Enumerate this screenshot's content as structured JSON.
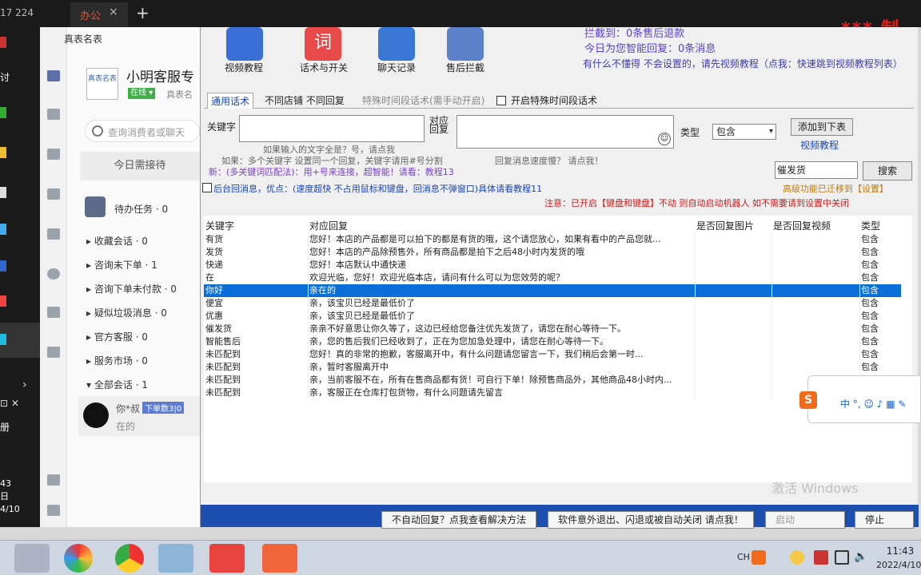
{
  "browser": {
    "left_text": "17 224",
    "tab_label": "办公",
    "close": "×",
    "new_tab": "+",
    "overlay_text": "*** 制"
  },
  "left_strip": {
    "clock_lines": [
      "43",
      "日",
      "4/10"
    ],
    "side_chars": [
      "讨",
      "册"
    ]
  },
  "customer_panel": {
    "title": "真表名表",
    "logo_text": "真表名表",
    "name": "小明客服专",
    "status": "在线 ▾",
    "sub": "真表名",
    "search_placeholder": "查询消费者或聊天",
    "today_button": "今日需接待",
    "todo_label": "待办任务 · 0",
    "rows": [
      "▸ 收藏会话 · 0",
      "▸ 咨询未下单 · 1",
      "▸ 咨询下单未付款 · 0",
      "▸ 疑似垃圾消息 · 0",
      "▸ 官方客服 · 0",
      "▸ 服务市场 · 0",
      "▾ 全部会话 · 1"
    ],
    "chat": {
      "name": "你*叔",
      "tag": "下单数3|0",
      "msg": "在的"
    }
  },
  "toolbar": {
    "items": [
      {
        "label": "视频教程",
        "color": "#3a6fd8"
      },
      {
        "label": "话术与开关",
        "color": "#e84a4a"
      },
      {
        "label": "聊天记录",
        "color": "#3a78d8"
      },
      {
        "label": "售后拦截",
        "color": "#5b82c8"
      }
    ]
  },
  "notices": {
    "line1": "拦截到：0条售后退款",
    "line2": "今日为您智能回复：0条消息",
    "line3": "有什么不懂得 不会设置的，请先视频教程（点我：快速跳到视频教程列表）"
  },
  "tabs": [
    "通用话术",
    "不同店铺 不同回复",
    "特殊时间段话术(需手动开启)",
    "开启特殊时间段话术"
  ],
  "form": {
    "keyword_label": "关键字",
    "reply_label": "对应回复",
    "type_label": "类型",
    "type_value": "包含",
    "add_button": "添加到下表",
    "video_link": "视频教程",
    "hint1": "如果输入的文字全是？号，请点我",
    "hint2": "如果：多个关键字 设置同一个回复，关键字请用#号分割",
    "hint3": "回复消息速度慢？ 请点我！",
    "hint4": "新：(多关键词匹配法)：用+号来连接，超智能！请看：教程13",
    "search_value": "催发货",
    "search_button": "搜索",
    "adv_note": "高级功能已迁移到【设置】",
    "bg_label": "后台回消息，优点：(速度超快 不占用鼠标和键盘，回消息不弹窗口)具体请看教程11",
    "warn": "注意：已开启【键盘和键盘】不动 则自动启动机器人 如不需要请到设置中关闭"
  },
  "table": {
    "headers": [
      "关键字",
      "对应回复",
      "是否回复图片",
      "是否回复视频",
      "类型"
    ],
    "rows": [
      [
        "有货",
        "您好！本店的产品都是可以拍下的都是有货的哦，这个请您放心，如果有看中的产品您就...",
        " ",
        " ",
        "包含"
      ],
      [
        "发货",
        "您好！本店的产品除预售外，所有商品都是拍下之后48小时内发货的哦",
        " ",
        " ",
        "包含"
      ],
      [
        "快递",
        "您好！本店默认中通快递",
        " ",
        " ",
        "包含"
      ],
      [
        "在",
        "欢迎光临，您好！欢迎光临本店，请问有什么可以为您效劳的呢？",
        " ",
        " ",
        "包含"
      ],
      [
        "你好",
        "亲在的",
        " ",
        " ",
        "包含"
      ],
      [
        "便宜",
        "亲，该宝贝已经是最低价了",
        " ",
        " ",
        "包含"
      ],
      [
        "优惠",
        "亲，该宝贝已经是最低价了",
        " ",
        " ",
        "包含"
      ],
      [
        "催发货",
        "亲亲不好意思让你久等了，这边已经给您备注优先发货了，请您在耐心等待一下。",
        " ",
        " ",
        "包含"
      ],
      [
        "智能售后",
        "亲，您的售后我们已经收到了，正在为您加急处理中，请您在耐心等待一下。",
        " ",
        " ",
        "包含"
      ],
      [
        "未匹配到",
        "您好！真的非常的抱歉，客服离开中，有什么问题请您留言一下，我们稍后会第一时...",
        " ",
        " ",
        "包含"
      ],
      [
        "未匹配到",
        "亲，暂时客服离开中",
        " ",
        " ",
        "包含"
      ],
      [
        "未匹配到",
        "亲，当前客服不在，所有在售商品都有货！可自行下单！除预售商品外，其他商品48小时内...",
        " ",
        " ",
        "包含"
      ],
      [
        "未匹配到",
        "亲，客服正在仓库打包货物，有什么问题请先留言",
        " ",
        " ",
        ""
      ]
    ],
    "selected_index": 4
  },
  "bottom": {
    "btn1": "不自动回复？点我查看解决方法",
    "btn2": "软件意外退出、闪退或被自动关闭 请点我！",
    "btn3": "启动",
    "btn4": "停止",
    "watermark": "激活 Windows"
  },
  "ime": {
    "logo": "S",
    "items": "中 °, ☺ ♪ ▦ ✎"
  },
  "taskbar": {
    "tray_lang": "CH",
    "time": "11:43",
    "date": "2022/4/10"
  }
}
